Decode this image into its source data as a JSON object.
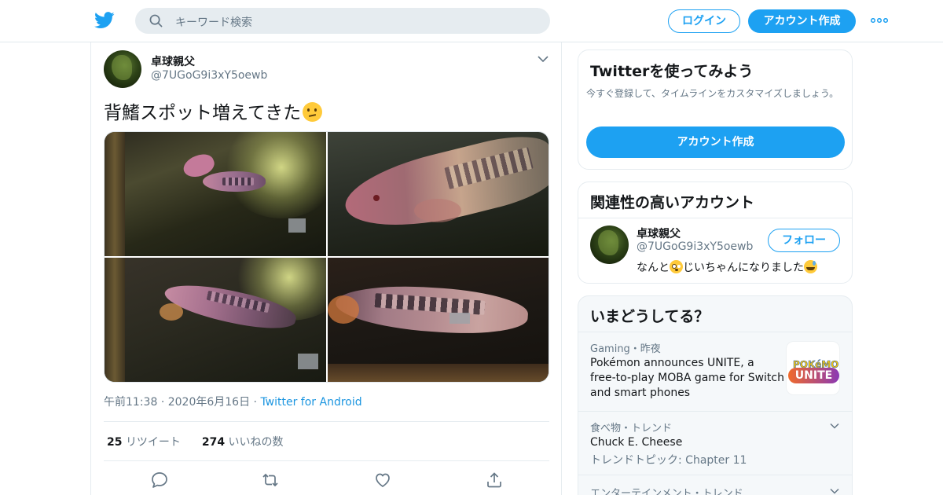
{
  "header": {
    "search_placeholder": "キーワード検索",
    "login_label": "ログイン",
    "signup_label": "アカウント作成"
  },
  "tweet": {
    "author_name": "卓球親父",
    "author_handle": "@7UGoG9i3xY5oewb",
    "text": "背鰭スポット増えてきた",
    "time": "午前11:38",
    "date": "2020年6月16日",
    "source": "Twitter for Android",
    "retweets_count": "25",
    "retweets_label": "リツイート",
    "likes_count": "274",
    "likes_label": "いいねの数"
  },
  "sidebar": {
    "try_twitter": {
      "title": "Twitterを使ってみよう",
      "desc": "今すぐ登録して、タイムラインをカスタマイズしましょう。",
      "button": "アカウント作成"
    },
    "relevant": {
      "title": "関連性の高いアカウント",
      "name": "卓球親父",
      "handle": "@7UGoG9i3xY5oewb",
      "follow_label": "フォロー",
      "bio_part1": "なんと",
      "bio_part2": "じいちゃんになりました"
    },
    "trends": {
      "title": "いまどうしてる？",
      "items": [
        {
          "context": "Gaming・昨夜",
          "title": "Pokémon announces UNITE, a free-to-play MOBA game for Switch and smart phones",
          "title_lines": [
            "Pokémon announces UNITE, a",
            "free-to-play MOBA game for Switch",
            "and smart phones"
          ],
          "thumb_line1": "POKéMON",
          "thumb_line2": "UNITE"
        },
        {
          "context": "食べ物・トレンド",
          "title": "Chuck E. Cheese",
          "subtitle": "トレンドトピック: Chapter 11"
        },
        {
          "context": "エンターテインメント・トレンド"
        }
      ]
    }
  },
  "colors": {
    "accent": "#1da1f2",
    "link": "#1b95e0",
    "muted": "#657786"
  }
}
